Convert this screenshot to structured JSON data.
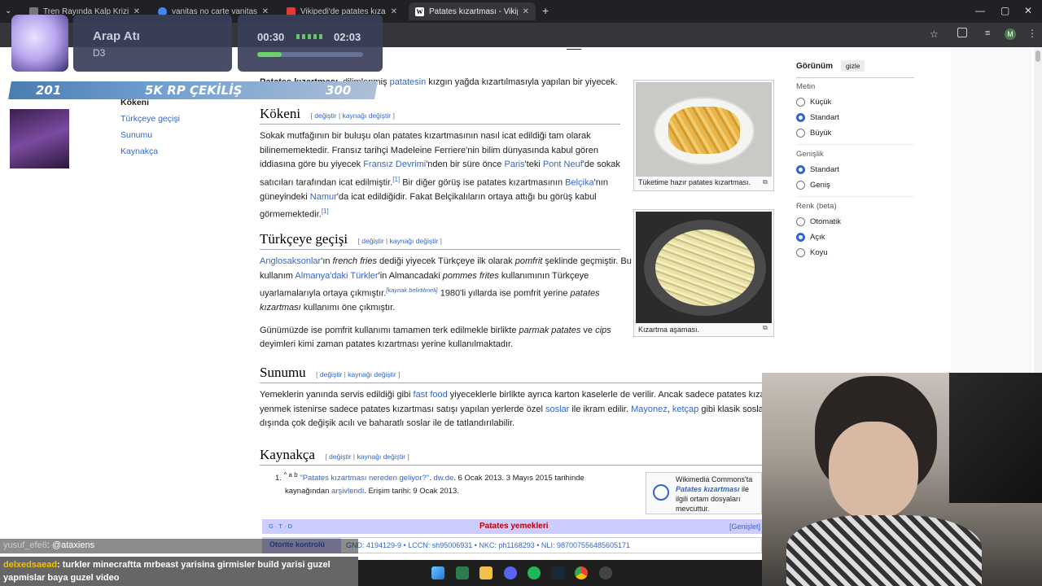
{
  "browser": {
    "tabs": [
      {
        "title": "Tren Rayında Kalp Krizi - Gö",
        "fav": "#777"
      },
      {
        "title": "vanitas no carte vanitas - Goog",
        "fav": "#4285f4"
      },
      {
        "title": "Vikipedi'de patates kızartmasın",
        "fav": "#e53935"
      },
      {
        "title": "Patates kızartması - Vikipedi",
        "fav": "#ffffff"
      }
    ],
    "new_tab": "+",
    "profile_initial": "M"
  },
  "stream": {
    "song_title": "Arap Atı",
    "song_sub": "D3",
    "time_current": "00:30",
    "time_total": "02:03",
    "progress": 0.23,
    "strip_left": "201",
    "strip_center": "5K RP ÇEKİLİŞ",
    "strip_right": "300",
    "chat": [
      {
        "user": "yusuf_efe6",
        "text": ": @ataxiens"
      },
      {
        "user": "delxedsaead",
        "text": ": turkler minecraftta mrbeast yarisina girmisler build yarisi guzel yapmislar baya guzel video"
      }
    ]
  },
  "wiki": {
    "toc": [
      "Kökeni",
      "Türkçeye geçişi",
      "Sunumu",
      "Kaynakça"
    ],
    "lead": {
      "bold": "Patates kızartması",
      "t1": ", dilimlenmiş ",
      "link": "patatesin",
      "t2": " kızgın yağda kızartılmasıyla yapılan bir yiyecek."
    },
    "edit": {
      "a": "değiştir",
      "b": "kaynağı değiştir"
    },
    "sections": {
      "kokeni": "Kökeni",
      "turkceye": "Türkçeye geçişi",
      "sunumu": "Sunumu",
      "kaynakca": "Kaynakça"
    },
    "p_kokeni": {
      "l1": "Sokak mutfağının bir buluşu olan patates kızartmasının nasıl icat edildiği tam olarak",
      "l2": "bilinememektedir. Fransız tarihçi Madeleine Ferriere'nin bilim dünyasında kabul gören",
      "l3a": "iddiasına göre bu yiyecek ",
      "l3l1": "Fransız Devrimi",
      "l3b": "'nden bir süre önce ",
      "l3l2": "Paris",
      "l3c": "'teki ",
      "l3l3": "Pont Neuf",
      "l3d": "'de sokak",
      "l4a": "satıcıları tarafından icat edilmiştir.",
      "l4ref": "[1]",
      "l4b": " Bir diğer görüş ise patates kızartmasının ",
      "l4l": "Belçika",
      "l4c": "'nın",
      "l5a": "güneyindeki ",
      "l5l": "Namur",
      "l5b": "'da icat edildiğidir. Fakat Belçikalıların ortaya attığı bu görüş kabul",
      "l6a": "görmemektedir.",
      "l6ref": "[1]"
    },
    "p_turk": {
      "l1l": "Anglosaksonlar",
      "l1a": "'ın ",
      "l1i": "french fries",
      "l1b": " dediği yiyecek Türkçeye ilk olarak ",
      "l1i2": "pomfrit",
      "l1c": " şeklinde geçmiştir. Bu",
      "l2a": "kullanım ",
      "l2l": "Almanya'daki Türkler",
      "l2b": "'in Almancadaki ",
      "l2i": "pommes frites",
      "l2c": " kullanımının Türkçeye",
      "l3a": "uyarlamalarıyla ortaya çıkmıştır.",
      "l3ref": "[kaynak belirtilmeli]",
      "l3b": " 1980'li yıllarda ise pomfrit yerine ",
      "l3i": "patates",
      "l4i": "kızartması",
      "l4a": " kullanımı öne çıkmıştır.",
      "l5a": "Günümüzde ise pomfrit kullanımı tamamen terk edilmekle birlikte ",
      "l5i": "parmak patates",
      "l5b": " ve ",
      "l5i2": "cips",
      "l6a": "deyimleri kimi zaman patates kızartması yerine kullanılmaktadır."
    },
    "p_sunum": {
      "l1a": "Yemeklerin yanında servis edildiği gibi ",
      "l1l": "fast food",
      "l1b": " yiyeceklerle birlikte ayrıca karton kaselerle de verilir. Ancak sadece patates kızartm",
      "l2a": "yenmek istenirse sadece patates kızartması satışı yapılan yerlerde özel ",
      "l2l": "soslar",
      "l2b": " ile ikram edilir. ",
      "l2l2": "Mayonez",
      "l2c": ", ",
      "l2l3": "ketçap",
      "l2d": " gibi klasik sosların",
      "l3": "dışında çok değişik acılı ve baharatlı soslar ile de tatlandırılabilir."
    },
    "ref": {
      "num": "1.",
      "up": "^ a b",
      "title": "\"Patates kızartması nereden geliyor?\"",
      "site": "dw.de",
      "t1": ". 6 Ocak 2013. 3 Mayıs 2015 tarihinde",
      "t2": "kaynağından ",
      "arsiv": "arşivlendi",
      "t3": ". Erişim tarihi: 9 Ocak 2013."
    },
    "commons": {
      "l1": "Wikimedia Commons'ta",
      "l2": "Patates kızartması",
      "l2b": " ile",
      "l3": "ilgili ortam dosyaları",
      "l4": "mevcuttur."
    },
    "navbox": {
      "vte": "G · T · D",
      "title": "Patates yemekleri",
      "expand": "[Genişlet]"
    },
    "authority": {
      "label": "Otorite kontrolü",
      "text": "GND: 4194129-9 • LCCN: sh95006931 • NKC: ph1168293 • NLI: 987007556485605171"
    },
    "images": [
      {
        "caption": "Tüketime hazır patates kızartması."
      },
      {
        "caption": "Kızartma aşaması."
      }
    ],
    "appearance": {
      "title": "Görünüm",
      "hide": "gizle",
      "text_label": "Metin",
      "text_opts": [
        "Küçük",
        "Standart",
        "Büyük"
      ],
      "text_sel": 1,
      "width_label": "Genişlik",
      "width_opts": [
        "Standart",
        "Geniş"
      ],
      "width_sel": 0,
      "color_label": "Renk (beta)",
      "color_opts": [
        "Otomatik",
        "Açık",
        "Koyu"
      ],
      "color_sel": 1
    }
  }
}
